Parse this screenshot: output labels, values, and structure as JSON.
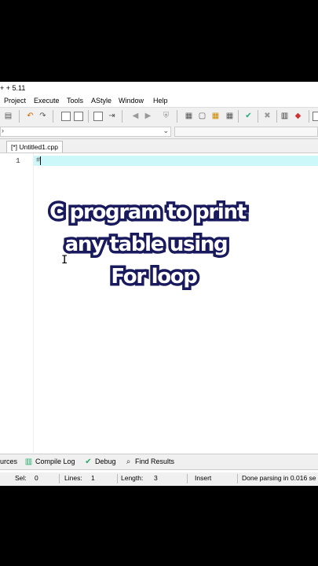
{
  "window": {
    "title_fragment": "+ + 5.11"
  },
  "menu": [
    "Project",
    "Execute",
    "Tools",
    "AStyle",
    "Window",
    "Help"
  ],
  "tab": {
    "label": "[*] Untitled1.cpp"
  },
  "editor": {
    "line_number": "1",
    "code_text": "#",
    "cursor_glyph": "I"
  },
  "overlay": {
    "line1": "C program to print",
    "line2": "any table using",
    "line3": "For loop"
  },
  "bottom_tabs": {
    "resources": "urces",
    "compile_log": "Compile Log",
    "debug": "Debug",
    "find_results": "Find Results"
  },
  "status": {
    "sel_label": "Sel:",
    "sel_value": "0",
    "lines_label": "Lines:",
    "lines_value": "1",
    "length_label": "Length:",
    "length_value": "3",
    "mode": "Insert",
    "message": "Done parsing in 0.016 se"
  },
  "colors": {
    "current_line": "#cdf8fa",
    "overlay_text": "#ffffff",
    "overlay_outline": "#1a1a5e"
  }
}
